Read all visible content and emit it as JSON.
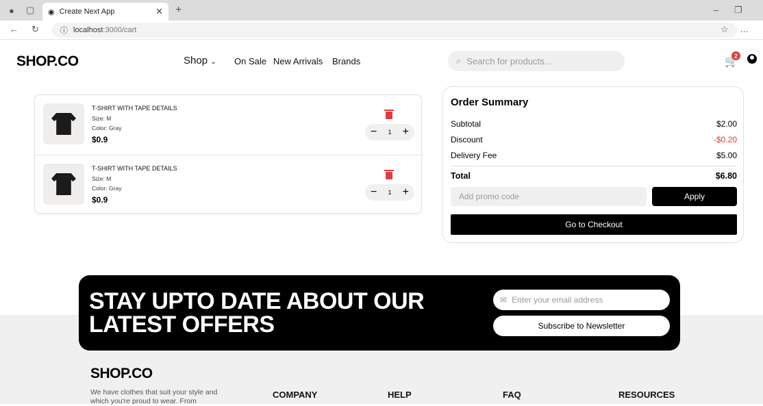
{
  "browser": {
    "tab_title": "Create Next App",
    "url_host": "localhost",
    "url_path": ":3000/cart"
  },
  "nav": {
    "logo": "SHOP.CO",
    "shop": "Shop",
    "on_sale": "On Sale",
    "new_arrivals": "New Arrivals",
    "brands": "Brands",
    "search_placeholder": "Search for products...",
    "cart_count": "2"
  },
  "cart": {
    "items": [
      {
        "name": "T-SHIRT WITH TAPE DETAILS",
        "size": "Size: M",
        "color": "Color: Gray",
        "price": "$0.9",
        "qty": "1"
      },
      {
        "name": "T-SHIRT WITH TAPE DETAILS",
        "size": "Size: M",
        "color": "Color: Gray",
        "price": "$0.9",
        "qty": "1"
      }
    ]
  },
  "summary": {
    "title": "Order Summary",
    "subtotal_label": "Subtotal",
    "subtotal_value": "$2.00",
    "discount_label": "Discount",
    "discount_value": "-$0.20",
    "delivery_label": "Delivery Fee",
    "delivery_value": "$5.00",
    "total_label": "Total",
    "total_value": "$6.80",
    "promo_placeholder": "Add promo code",
    "apply_label": "Apply",
    "checkout_label": "Go to Checkout"
  },
  "newsletter": {
    "title": "STAY UPTO DATE ABOUT OUR LATEST OFFERS",
    "email_placeholder": "Enter your email address",
    "subscribe_label": "Subscribe to Newsletter"
  },
  "footer": {
    "logo": "SHOP.CO",
    "description": "We have clothes that suit your style and which you're proud to wear. From",
    "columns": [
      "COMPANY",
      "HELP",
      "FAQ",
      "RESOURCES"
    ]
  },
  "colors": {
    "accent_red": "#e23b3b",
    "primary_black": "#000000"
  }
}
